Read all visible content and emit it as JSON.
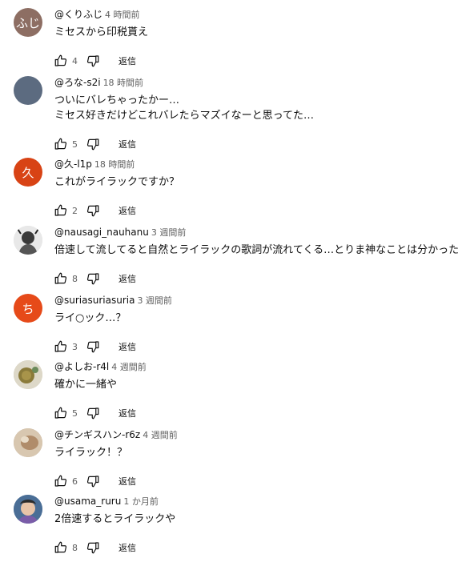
{
  "reply_label": "返信",
  "comments": [
    {
      "avatar_text": "ふじ",
      "avatar_color": "#8d6e63",
      "author": "@くりふじ",
      "time": "4 時間前",
      "text_lines": [
        "ミセスから印税貰え"
      ],
      "likes": "4"
    },
    {
      "avatar_text": "",
      "avatar_color": "#5c6b80",
      "author": "@ろな-s2i",
      "time": "18 時間前",
      "text_lines": [
        "ついにバレちゃったかー…",
        "ミセス好きだけどこれバレたらマズイなーと思ってた…"
      ],
      "likes": "5"
    },
    {
      "avatar_text": "久",
      "avatar_color": "#d84315",
      "author": "@久-l1p",
      "time": "18 時間前",
      "text_lines": [
        "これがライラックですか？"
      ],
      "likes": "2"
    },
    {
      "avatar_text": "",
      "avatar_color": "#d9d9d9",
      "author": "@nausagi_nauhanu",
      "time": "3 週間前",
      "text_lines": [
        "倍速して流してると自然とライラックの歌詞が流れてくる…とりま神なことは分かった"
      ],
      "likes": "8"
    },
    {
      "avatar_text": "ち",
      "avatar_color": "#e64a19",
      "author": "@suriasuriasuria",
      "time": "3 週間前",
      "text_lines": [
        "ライ○ック…？"
      ],
      "likes": "3"
    },
    {
      "avatar_text": "",
      "avatar_color": "#c8c0a8",
      "author": "@よしお-r4l",
      "time": "4 週間前",
      "text_lines": [
        "確かに一緒や"
      ],
      "likes": "5"
    },
    {
      "avatar_text": "",
      "avatar_color": "#b8a48e",
      "author": "@チンギスハン-r6z",
      "time": "4 週間前",
      "text_lines": [
        "ライラック！？"
      ],
      "likes": "6"
    },
    {
      "avatar_text": "",
      "avatar_color": "#5a7fa8",
      "author": "@usama_ruru",
      "time": "1 か月前",
      "text_lines": [
        "2倍速するとライラックや"
      ],
      "likes": "8"
    }
  ]
}
